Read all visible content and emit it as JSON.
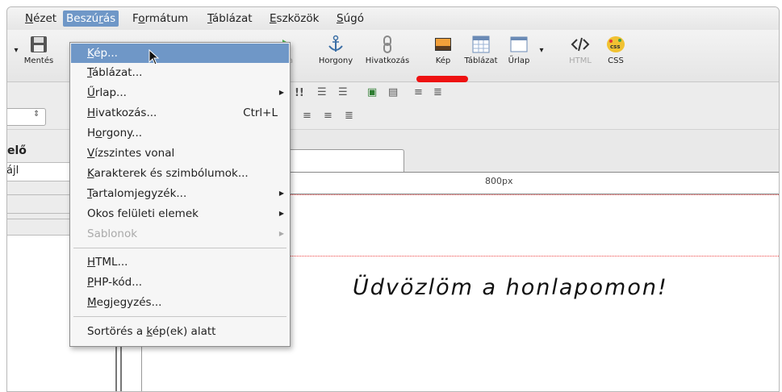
{
  "menubar": {
    "items": [
      {
        "pre": "",
        "u": "N",
        "post": "ézet"
      },
      {
        "pre": "Beszú",
        "u": "r",
        "post": "ás"
      },
      {
        "pre": "F",
        "u": "o",
        "post": "rmátum"
      },
      {
        "pre": "",
        "u": "T",
        "post": "áblázat"
      },
      {
        "pre": "",
        "u": "E",
        "post": "szközök"
      },
      {
        "pre": "",
        "u": "S",
        "post": "úgó"
      }
    ]
  },
  "toolbar": {
    "save_label": "Mentés",
    "partial_label": "ra",
    "anchor_label": "Horgony",
    "link_label": "Hivatkozás",
    "image_label": "Kép",
    "table_label": "Táblázat",
    "form_label": "Űrlap",
    "html_label": "HTML",
    "css_label": "CSS",
    "css_icon_text": "css"
  },
  "left_panel": {
    "header": "elő",
    "file_row": "ájl"
  },
  "editor": {
    "ruler_label": "800px",
    "heading": "Üdvözlöm a honlapomon!"
  },
  "insert_menu": {
    "items": [
      {
        "pre": "",
        "u": "K",
        "post": "ép...",
        "shortcut": "",
        "submenu": false
      },
      {
        "pre": "",
        "u": "T",
        "post": "áblázat...",
        "shortcut": "",
        "submenu": false
      },
      {
        "pre": "",
        "u": "Ű",
        "post": "rlap...",
        "shortcut": "",
        "submenu": true
      },
      {
        "pre": "",
        "u": "H",
        "post": "ivatkozás...",
        "shortcut": "Ctrl+L",
        "submenu": false
      },
      {
        "pre": "H",
        "u": "o",
        "post": "rgony...",
        "shortcut": "",
        "submenu": false
      },
      {
        "pre": "",
        "u": "V",
        "post": "ízszintes vonal",
        "shortcut": "",
        "submenu": false
      },
      {
        "pre": "",
        "u": "K",
        "post": "arakterek és szimbólumok...",
        "shortcut": "",
        "submenu": false
      },
      {
        "pre": "",
        "u": "T",
        "post": "artalomjegyzék...",
        "shortcut": "",
        "submenu": true
      },
      {
        "pre": "",
        "u": "",
        "post": "Okos felületi elemek",
        "shortcut": "",
        "submenu": true
      },
      {
        "pre": "",
        "u": "",
        "post": "Sablonok",
        "shortcut": "",
        "submenu": true
      },
      {
        "pre": "",
        "u": "H",
        "post": "TML...",
        "shortcut": "",
        "submenu": false
      },
      {
        "pre": "",
        "u": "P",
        "post": "HP-kód...",
        "shortcut": "",
        "submenu": false
      },
      {
        "pre": "",
        "u": "M",
        "post": "egjegyzés...",
        "shortcut": "",
        "submenu": false
      },
      {
        "pre": "Sortörés a ",
        "u": "k",
        "post": "ép(ek) alatt",
        "shortcut": "",
        "submenu": false
      }
    ]
  },
  "colors": {
    "highlight": "#6f97c7",
    "annotation_red": "#ee1111"
  }
}
